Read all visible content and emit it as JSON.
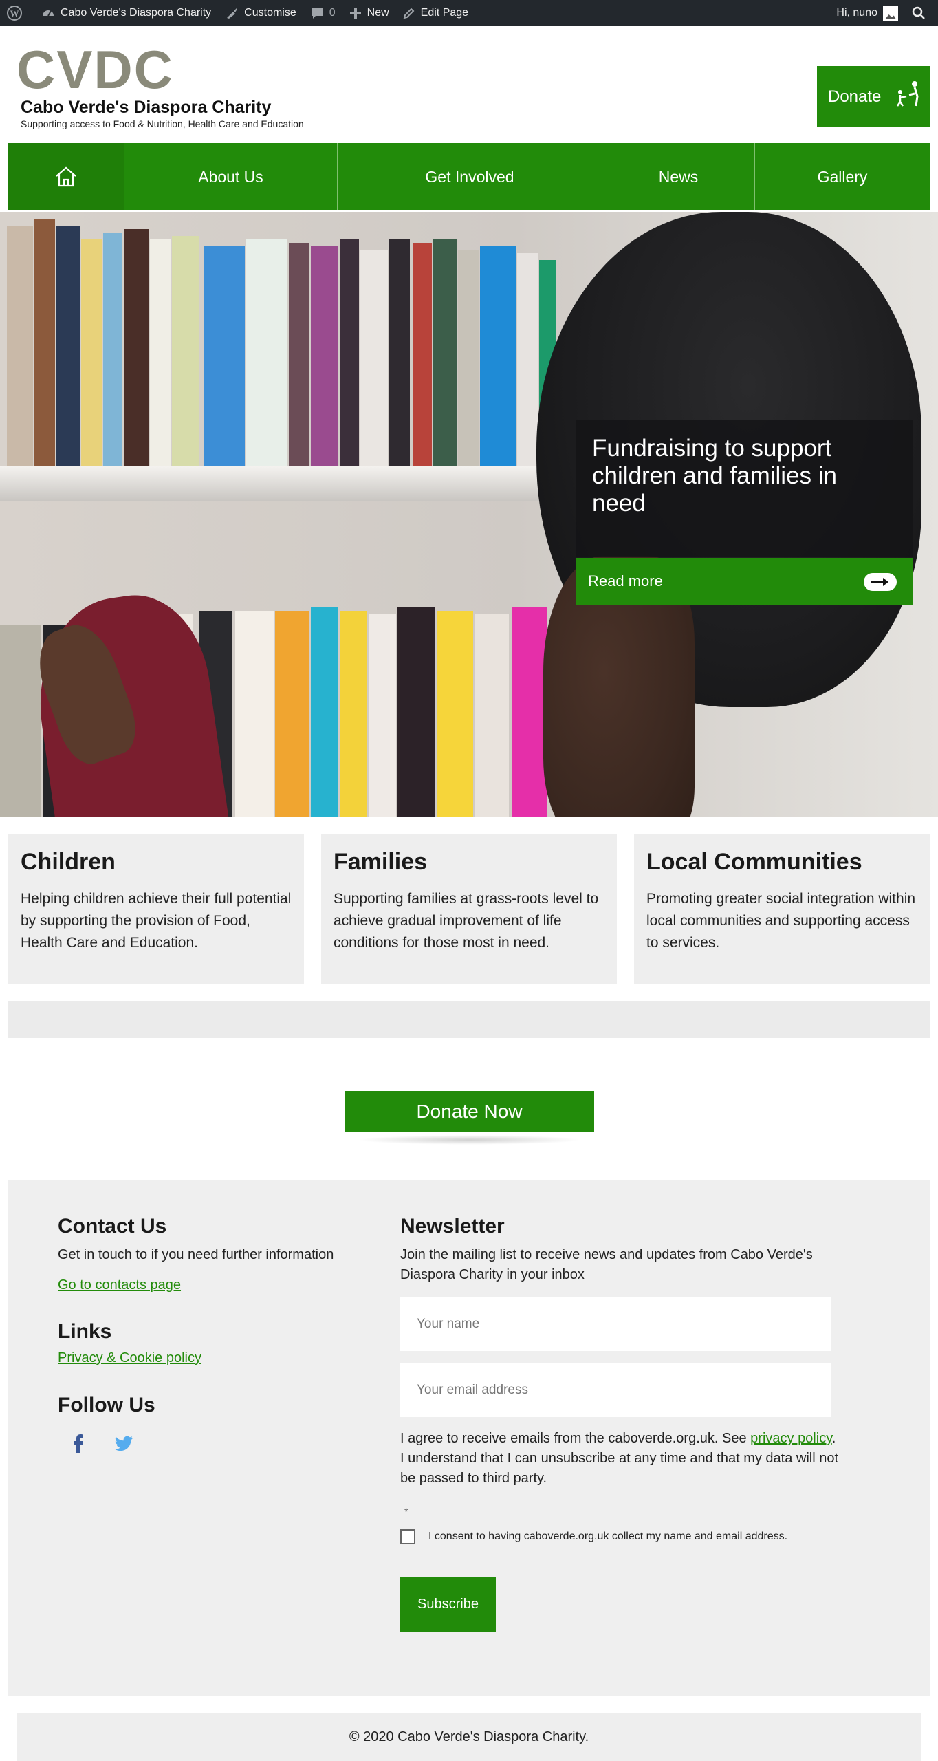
{
  "admin_bar": {
    "site_name": "Cabo Verde's Diaspora Charity",
    "customise": "Customise",
    "comments_count": "0",
    "new": "New",
    "edit_page": "Edit Page",
    "greeting": "Hi, nuno"
  },
  "header": {
    "logo": "CVDC",
    "title": "Cabo Verde's Diaspora Charity",
    "tagline": "Supporting access to Food & Nutrition, Health Care and Education",
    "donate": "Donate"
  },
  "nav": {
    "items": [
      {
        "label": "About Us"
      },
      {
        "label": "Get Involved"
      },
      {
        "label": "News"
      },
      {
        "label": "Gallery"
      }
    ]
  },
  "hero": {
    "heading": "Fundraising to support children and families in need",
    "read_more": "Read more"
  },
  "cards": [
    {
      "title": "Children",
      "text": "Helping children achieve their full potential by supporting the provision of Food, Health Care and Education."
    },
    {
      "title": "Families",
      "text": "Supporting families at grass-roots level to achieve gradual improvement of life conditions for those most in need."
    },
    {
      "title": "Local Communities",
      "text": "Promoting greater social integration within local communities and supporting access to services."
    }
  ],
  "donate_now": "Donate Now",
  "footer": {
    "contact_heading": "Contact Us",
    "contact_text": "Get in touch to if you need further information",
    "contact_link": "Go to contacts page",
    "links_heading": "Links",
    "privacy_link": "Privacy & Cookie policy",
    "follow_heading": "Follow Us",
    "newsletter_heading": "Newsletter",
    "newsletter_text": "Join the mailing list to receive news and updates from Cabo Verde's Diaspora Charity in your inbox",
    "name_placeholder": "Your name",
    "email_placeholder": "Your email address",
    "agree_text_before": "I agree to receive emails from the caboverde.org.uk. See",
    "agree_link": "privacy policy",
    "agree_text_after": ". I understand that I can unsubscribe at any time and that my data will not be passed to third party.",
    "required_mark": "*",
    "consent_text": "I consent to having caboverde.org.uk collect my name and email address.",
    "subscribe": "Subscribe"
  },
  "copyright": "© 2020 Cabo Verde's Diaspora Charity.",
  "colors": {
    "accent": "#228b0a",
    "admin_bar": "#23282d",
    "panel": "#efefef"
  },
  "icons": [
    "wordpress-icon",
    "dashboard-icon",
    "brush-icon",
    "comment-icon",
    "plus-icon",
    "pencil-icon",
    "avatar",
    "search-icon",
    "donate-figure-icon",
    "home-icon",
    "toggle-icon",
    "facebook-icon",
    "twitter-icon"
  ]
}
